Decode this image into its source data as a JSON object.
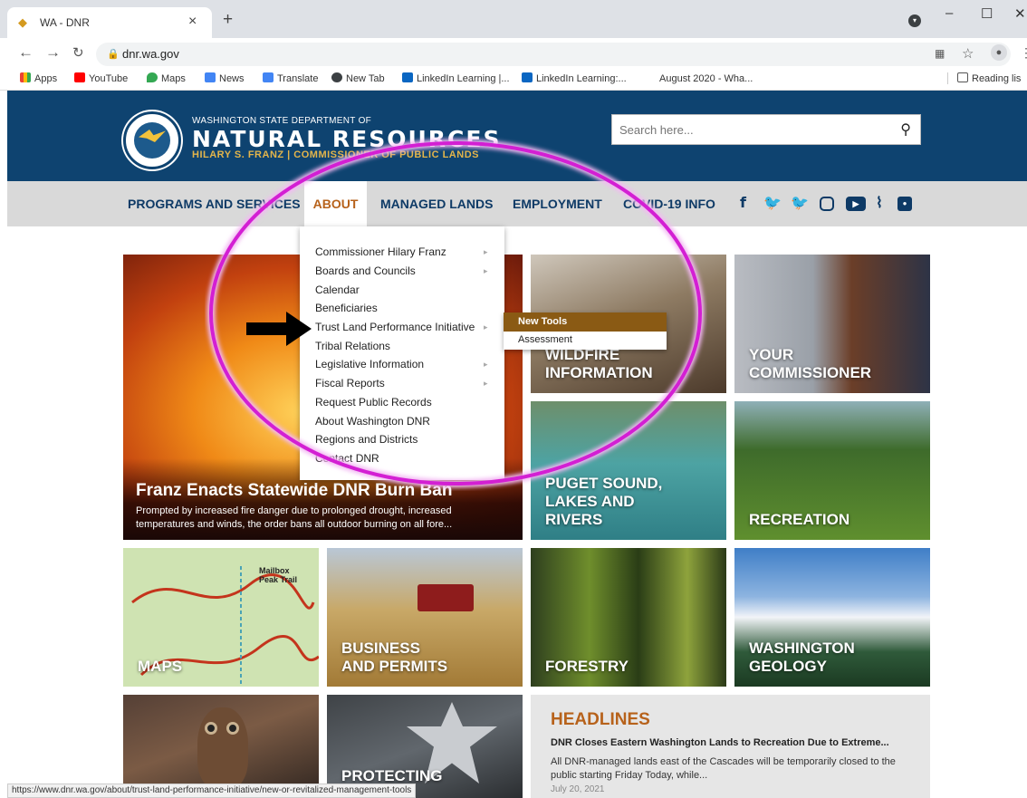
{
  "browser": {
    "tab_title": "WA - DNR",
    "tab_close": "×",
    "new_tab": "+",
    "url": "dnr.wa.gov",
    "window": {
      "minimize": "–",
      "maximize": "☐",
      "close": "✕"
    },
    "bookmarks": [
      {
        "label": "Apps",
        "color": "#4285f4"
      },
      {
        "label": "YouTube",
        "color": "#ff0000"
      },
      {
        "label": "Maps",
        "color": "#34a853"
      },
      {
        "label": "News",
        "color": "#4285f4"
      },
      {
        "label": "Translate",
        "color": "#4285f4"
      },
      {
        "label": "New Tab",
        "color": "#3c4043"
      },
      {
        "label": "LinkedIn Learning |...",
        "color": "#0a66c2"
      },
      {
        "label": "LinkedIn Learning:...",
        "color": "#0a66c2"
      },
      {
        "label": "August 2020 - Wha...",
        "color": "#ffffff"
      }
    ],
    "reading_list": "Reading lis",
    "status_url": "https://www.dnr.wa.gov/about/trust-land-performance-initiative/new-or-revitalized-management-tools"
  },
  "header": {
    "dept": "WASHINGTON STATE DEPARTMENT OF",
    "name": "NATURAL RESOURCES",
    "commissioner": "HILARY S. FRANZ | COMMISSIONER OF PUBLIC LANDS",
    "search_placeholder": "Search here...",
    "bg_color": "#0e4370"
  },
  "nav": {
    "items": [
      "PROGRAMS AND SERVICES",
      "ABOUT",
      "MANAGED LANDS",
      "EMPLOYMENT",
      "COVID-19 INFO"
    ],
    "social_icons": [
      "facebook-icon",
      "twitter-icon",
      "twitter-icon",
      "instagram-icon",
      "youtube-icon",
      "rss-icon",
      "flickr-icon"
    ],
    "active_color": "#b7621b"
  },
  "about_menu": {
    "items": [
      {
        "label": "Commissioner Hilary Franz",
        "submenu": true
      },
      {
        "label": "Boards and Councils",
        "submenu": true
      },
      {
        "label": "Calendar",
        "submenu": false
      },
      {
        "label": "Beneficiaries",
        "submenu": false
      },
      {
        "label": "Trust Land Performance Initiative",
        "submenu": true
      },
      {
        "label": "Tribal Relations",
        "submenu": false
      },
      {
        "label": "Legislative Information",
        "submenu": true
      },
      {
        "label": "Fiscal Reports",
        "submenu": true
      },
      {
        "label": "Request Public Records",
        "submenu": false
      },
      {
        "label": "About Washington DNR",
        "submenu": false
      },
      {
        "label": "Regions and Districts",
        "submenu": false
      },
      {
        "label": "Contact DNR",
        "submenu": false
      }
    ],
    "submenu": [
      "New Tools",
      "Assessment"
    ]
  },
  "hero": {
    "headline": "Franz Enacts Statewide DNR Burn Ban",
    "text": "Prompted by increased fire danger due to prolonged drought, increased temperatures and winds, the order bans all outdoor burning on all fore..."
  },
  "tiles": {
    "wildfire": "WILDFIRE\nINFORMATION",
    "commissioner": "YOUR\nCOMMISSIONER",
    "puget": "PUGET SOUND,\nLAKES AND\nRIVERS",
    "recreation": "RECREATION",
    "maps": "MAPS",
    "maps_trail": "Mailbox\nPeak Trail",
    "business": "BUSINESS\nAND PERMITS",
    "forestry": "FORESTRY",
    "geology": "WASHINGTON\nGEOLOGY",
    "protecting": "PROTECTING"
  },
  "headlines": {
    "title": "HEADLINES",
    "headline": "DNR Closes Eastern Washington Lands to Recreation Due to Extreme...",
    "text": "All DNR-managed lands east of the Cascades will be temporarily closed to the public starting Friday   Today, while...",
    "date": "July 20, 2021"
  },
  "annotation": {
    "ellipse_color": "#d31fd3",
    "arrow_color": "#000000"
  }
}
